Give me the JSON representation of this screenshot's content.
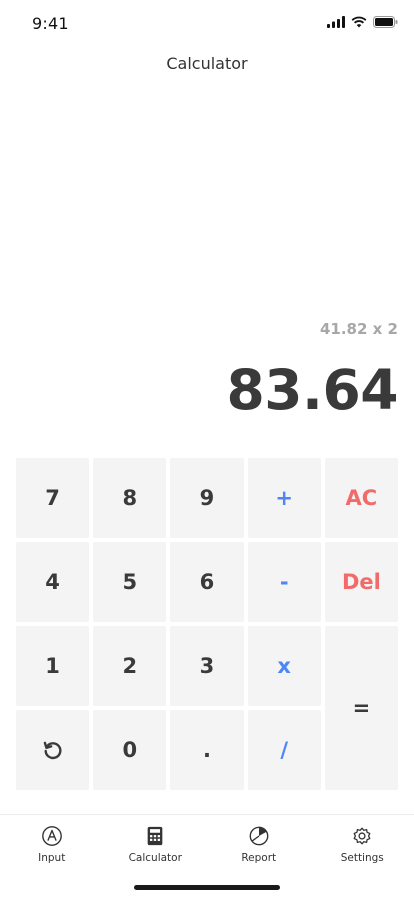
{
  "status": {
    "time": "9:41"
  },
  "title": "Calculator",
  "display": {
    "expression": "41.82 x 2",
    "result": "83.64"
  },
  "keys": [
    {
      "label": "7",
      "kind": "num"
    },
    {
      "label": "8",
      "kind": "num"
    },
    {
      "label": "9",
      "kind": "num"
    },
    {
      "label": "+",
      "kind": "op"
    },
    {
      "label": "AC",
      "kind": "danger"
    },
    {
      "label": "4",
      "kind": "num"
    },
    {
      "label": "5",
      "kind": "num"
    },
    {
      "label": "6",
      "kind": "num"
    },
    {
      "label": "-",
      "kind": "op"
    },
    {
      "label": "Del",
      "kind": "danger"
    },
    {
      "label": "1",
      "kind": "num"
    },
    {
      "label": "2",
      "kind": "num"
    },
    {
      "label": "3",
      "kind": "num"
    },
    {
      "label": "x",
      "kind": "op"
    },
    {
      "label": "=",
      "kind": "num"
    },
    {
      "label": "",
      "kind": "num",
      "icon": "undo-icon"
    },
    {
      "label": "0",
      "kind": "num"
    },
    {
      "label": ".",
      "kind": "num"
    },
    {
      "label": "/",
      "kind": "op"
    }
  ],
  "tabs": [
    {
      "label": "Input",
      "icon": "input-icon"
    },
    {
      "label": "Calculator",
      "icon": "calculator-icon"
    },
    {
      "label": "Report",
      "icon": "report-icon"
    },
    {
      "label": "Settings",
      "icon": "settings-icon"
    }
  ],
  "colors": {
    "operator": "#4f86f7",
    "danger": "#f26b6b",
    "key_bg": "#f4f4f4",
    "text": "#3a3a3a",
    "muted": "#a7a7a7"
  }
}
